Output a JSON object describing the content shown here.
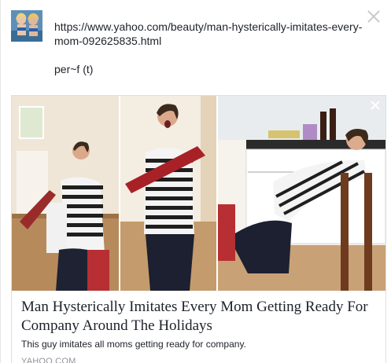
{
  "post": {
    "url_text": "https://www.yahoo.com/beauty/man-hysterically-imitates-every-mom-092625835.html",
    "signature": "per~f (t)"
  },
  "link_preview": {
    "title": "Man Hysterically Imitates Every Mom Getting Ready For Company Around The Holidays",
    "description": "This guy imitates all moms getting ready for company.",
    "domain": "YAHOO.COM"
  },
  "icons": {
    "close": "close-icon",
    "remove_preview": "close-icon"
  }
}
